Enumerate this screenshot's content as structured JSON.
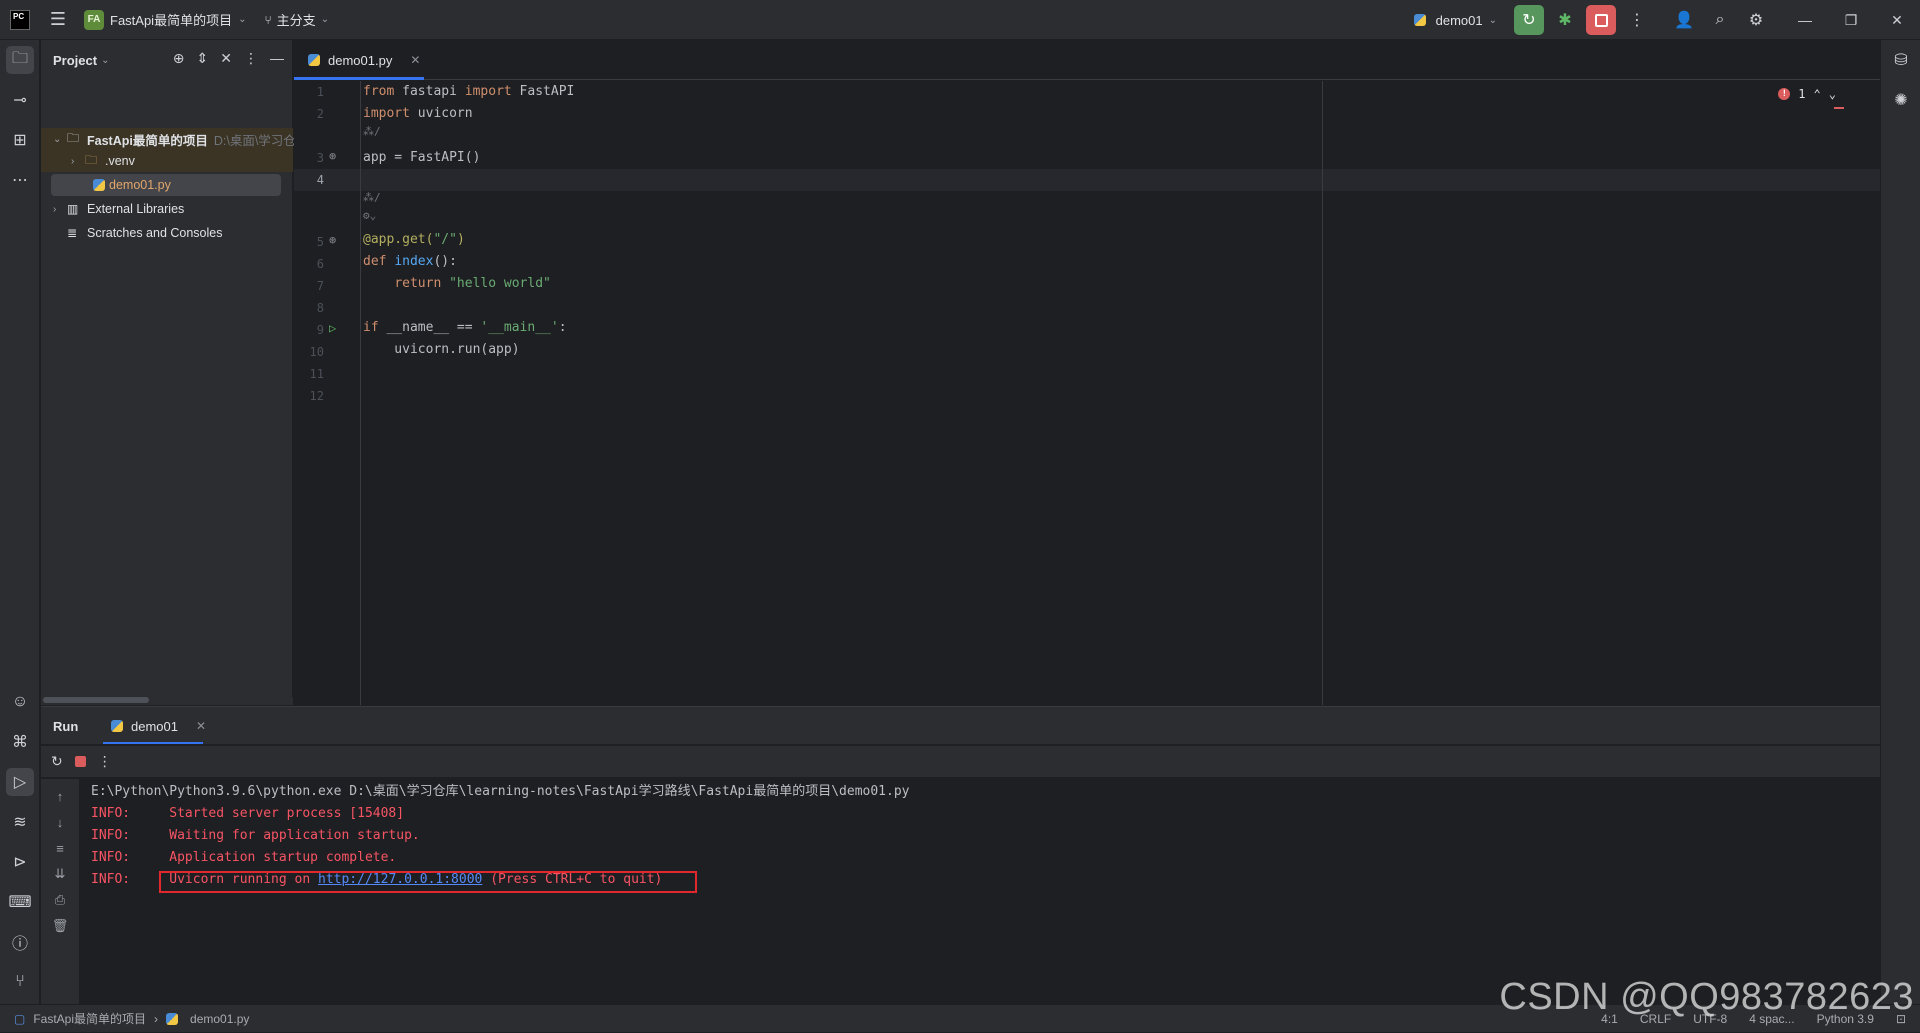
{
  "titlebar": {
    "logo_text": "PC",
    "project_badge": "FA",
    "project_name": "FastApi最简单的项目",
    "branch": "主分支",
    "run_config": "demo01"
  },
  "project_panel": {
    "title": "Project",
    "tree": [
      {
        "label": "FastApi最简单的项目",
        "hint": "D:\\桌面\\学习仓"
      },
      {
        "label": ".venv"
      },
      {
        "label": "demo01.py"
      },
      {
        "label": "External Libraries"
      },
      {
        "label": "Scratches and Consoles"
      }
    ]
  },
  "editor": {
    "tab_label": "demo01.py",
    "error_count": "1",
    "line_numbers": [
      "1",
      "2",
      "3",
      "4",
      "5",
      "6",
      "7",
      "8",
      "9",
      "10",
      "11",
      "12"
    ],
    "inlay_hints": [
      "⁂/",
      "⁂/",
      "⚙⌄"
    ]
  },
  "run_panel": {
    "title": "Run",
    "tab_label": "demo01",
    "console": {
      "command": "E:\\Python\\Python3.9.6\\python.exe D:\\桌面\\学习仓库\\learning-notes\\FastApi学习路线\\FastApi最简单的项目\\demo01.py",
      "lines": [
        {
          "level": "INFO:",
          "text": "Started server process [15408]"
        },
        {
          "level": "INFO:",
          "text": "Waiting for application startup."
        },
        {
          "level": "INFO:",
          "text": "Application startup complete."
        }
      ],
      "uvicorn": {
        "level": "INFO:",
        "prefix": "Uvicorn running on ",
        "link": "http://127.0.0.1:8000",
        "suffix": " (Press CTRL+C to quit)"
      }
    }
  },
  "statusbar": {
    "breadcrumb_project": "FastApi最简单的项目",
    "breadcrumb_file": "demo01.py",
    "position": "4:1",
    "line_sep": "CRLF",
    "encoding": "UTF-8",
    "indent": "4 spac...",
    "interpreter": "Python 3.9"
  },
  "watermark": "CSDN @QQ983782623"
}
